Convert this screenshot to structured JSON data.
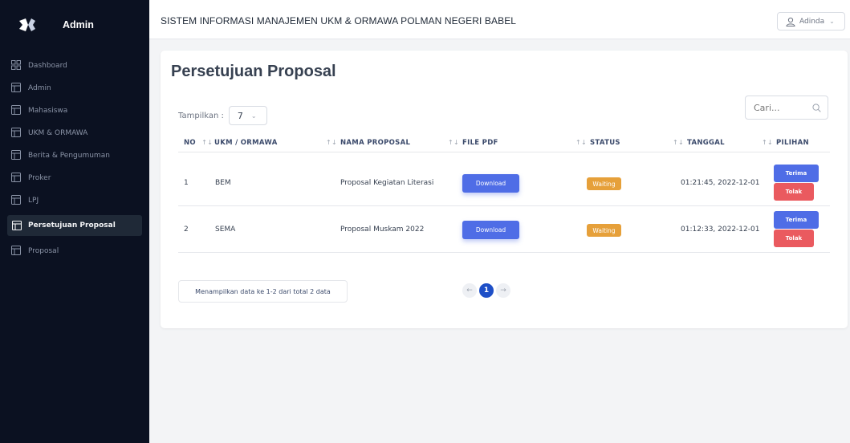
{
  "brand": {
    "title": "Admin"
  },
  "sidebar": {
    "items": [
      {
        "label": "Dashboard",
        "icon": "dashboard-grid-icon"
      },
      {
        "label": "Admin",
        "icon": "table-icon"
      },
      {
        "label": "Mahasiswa",
        "icon": "table-icon"
      },
      {
        "label": "UKM & ORMAWA",
        "icon": "table-icon"
      },
      {
        "label": "Berita & Pengumuman",
        "icon": "table-icon"
      },
      {
        "label": "Proker",
        "icon": "table-icon"
      },
      {
        "label": "LPJ",
        "icon": "table-icon"
      },
      {
        "label": "Persetujuan Proposal",
        "icon": "table-icon",
        "active": true
      },
      {
        "label": "Proposal",
        "icon": "table-icon"
      }
    ]
  },
  "topbar": {
    "title": "SISTEM INFORMASI MANAJEMEN UKM & ORMAWA POLMAN NEGERI BABEL",
    "user": "Adinda"
  },
  "main": {
    "title": "Persetujuan Proposal",
    "show_label": "Tampilkan :",
    "show_value": "7",
    "search_placeholder": "Cari..."
  },
  "table": {
    "headers": [
      "NO",
      "UKM / ORMAWA",
      "NAMA PROPOSAL",
      "FILE PDF",
      "STATUS",
      "TANGGAL",
      "PILIHAN"
    ],
    "rows": [
      {
        "no": "1",
        "ukm": "BEM",
        "proposal": "Proposal Kegiatan Literasi",
        "file": "Download",
        "status": "Waiting",
        "tanggal": "01:21:45, 2022-12-01",
        "accept": "Terima",
        "reject": "Tolak"
      },
      {
        "no": "2",
        "ukm": "SEMA",
        "proposal": "Proposal Muskam 2022",
        "file": "Download",
        "status": "Waiting",
        "tanggal": "01:12:33, 2022-12-01",
        "accept": "Terima",
        "reject": "Tolak"
      }
    ]
  },
  "footer": {
    "info": "Menampilkan data ke 1-2 dari total 2 data",
    "current_page": "1"
  },
  "colors": {
    "sidebar_bg": "#0b1121",
    "primary": "#4f6de6",
    "danger": "#ea5a5f",
    "warning": "#e6a03a",
    "page_active": "#1e4fc7"
  }
}
